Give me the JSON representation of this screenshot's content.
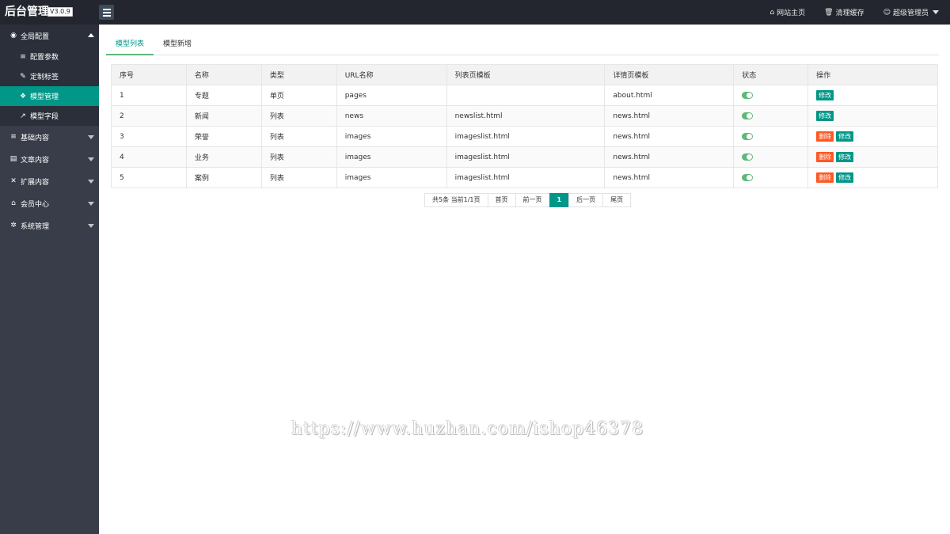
{
  "header": {
    "logo": "后台管理",
    "version": "V3.0.9",
    "links": [
      {
        "icon": "home-icon",
        "glyph": "⌂",
        "label": "网站主页"
      },
      {
        "icon": "trash-icon",
        "glyph": "🗑",
        "label": "清理缓存"
      },
      {
        "icon": "user-icon",
        "glyph": "☺",
        "label": "超级管理员"
      }
    ]
  },
  "sidebar": {
    "groups": [
      {
        "icon": "globe-icon",
        "glyph": "◉",
        "label": "全局配置",
        "open": true,
        "items": [
          {
            "icon": "sliders-icon",
            "glyph": "≡",
            "label": "配置参数"
          },
          {
            "icon": "wrench-icon",
            "glyph": "✎",
            "label": "定制标签"
          },
          {
            "icon": "cube-icon",
            "glyph": "❖",
            "label": "模型管理",
            "active": true
          },
          {
            "icon": "external-link-icon",
            "glyph": "↗",
            "label": "模型字段"
          }
        ]
      },
      {
        "icon": "sliders-icon",
        "glyph": "≡",
        "label": "基础内容"
      },
      {
        "icon": "file-icon",
        "glyph": "▤",
        "label": "文章内容"
      },
      {
        "icon": "expand-icon",
        "glyph": "✕",
        "label": "扩展内容"
      },
      {
        "icon": "lock-icon",
        "glyph": "⌂",
        "label": "会员中心"
      },
      {
        "icon": "gear-icon",
        "glyph": "✲",
        "label": "系统管理"
      }
    ]
  },
  "tabs": [
    "模型列表",
    "模型新增"
  ],
  "table": {
    "columns": [
      "序号",
      "名称",
      "类型",
      "URL名称",
      "列表页模板",
      "详情页模板",
      "状态",
      "操作"
    ],
    "rows": [
      {
        "id": "1",
        "name": "专题",
        "type": "单页",
        "url": "pages",
        "list_tpl": "",
        "detail_tpl": "about.html",
        "status": true,
        "actions": [
          "修改"
        ]
      },
      {
        "id": "2",
        "name": "新闻",
        "type": "列表",
        "url": "news",
        "list_tpl": "newslist.html",
        "detail_tpl": "news.html",
        "status": true,
        "actions": [
          "修改"
        ]
      },
      {
        "id": "3",
        "name": "荣誉",
        "type": "列表",
        "url": "images",
        "list_tpl": "imageslist.html",
        "detail_tpl": "news.html",
        "status": true,
        "actions": [
          "删除",
          "修改"
        ]
      },
      {
        "id": "4",
        "name": "业务",
        "type": "列表",
        "url": "images",
        "list_tpl": "imageslist.html",
        "detail_tpl": "news.html",
        "status": true,
        "actions": [
          "删除",
          "修改"
        ]
      },
      {
        "id": "5",
        "name": "案例",
        "type": "列表",
        "url": "images",
        "list_tpl": "imageslist.html",
        "detail_tpl": "news.html",
        "status": true,
        "actions": [
          "删除",
          "修改"
        ]
      }
    ]
  },
  "pager": {
    "summary": "共5条 当前1/1页",
    "first": "首页",
    "prev": "前一页",
    "current": "1",
    "next": "后一页",
    "last": "尾页"
  },
  "watermark": "https://www.huzhan.com/ishop46378",
  "colors": {
    "accent": "#009688",
    "danger": "#ff5722",
    "switch_on": "#5fb878",
    "sidebar_bg": "#393d49",
    "topbar_bg": "#23262e"
  }
}
